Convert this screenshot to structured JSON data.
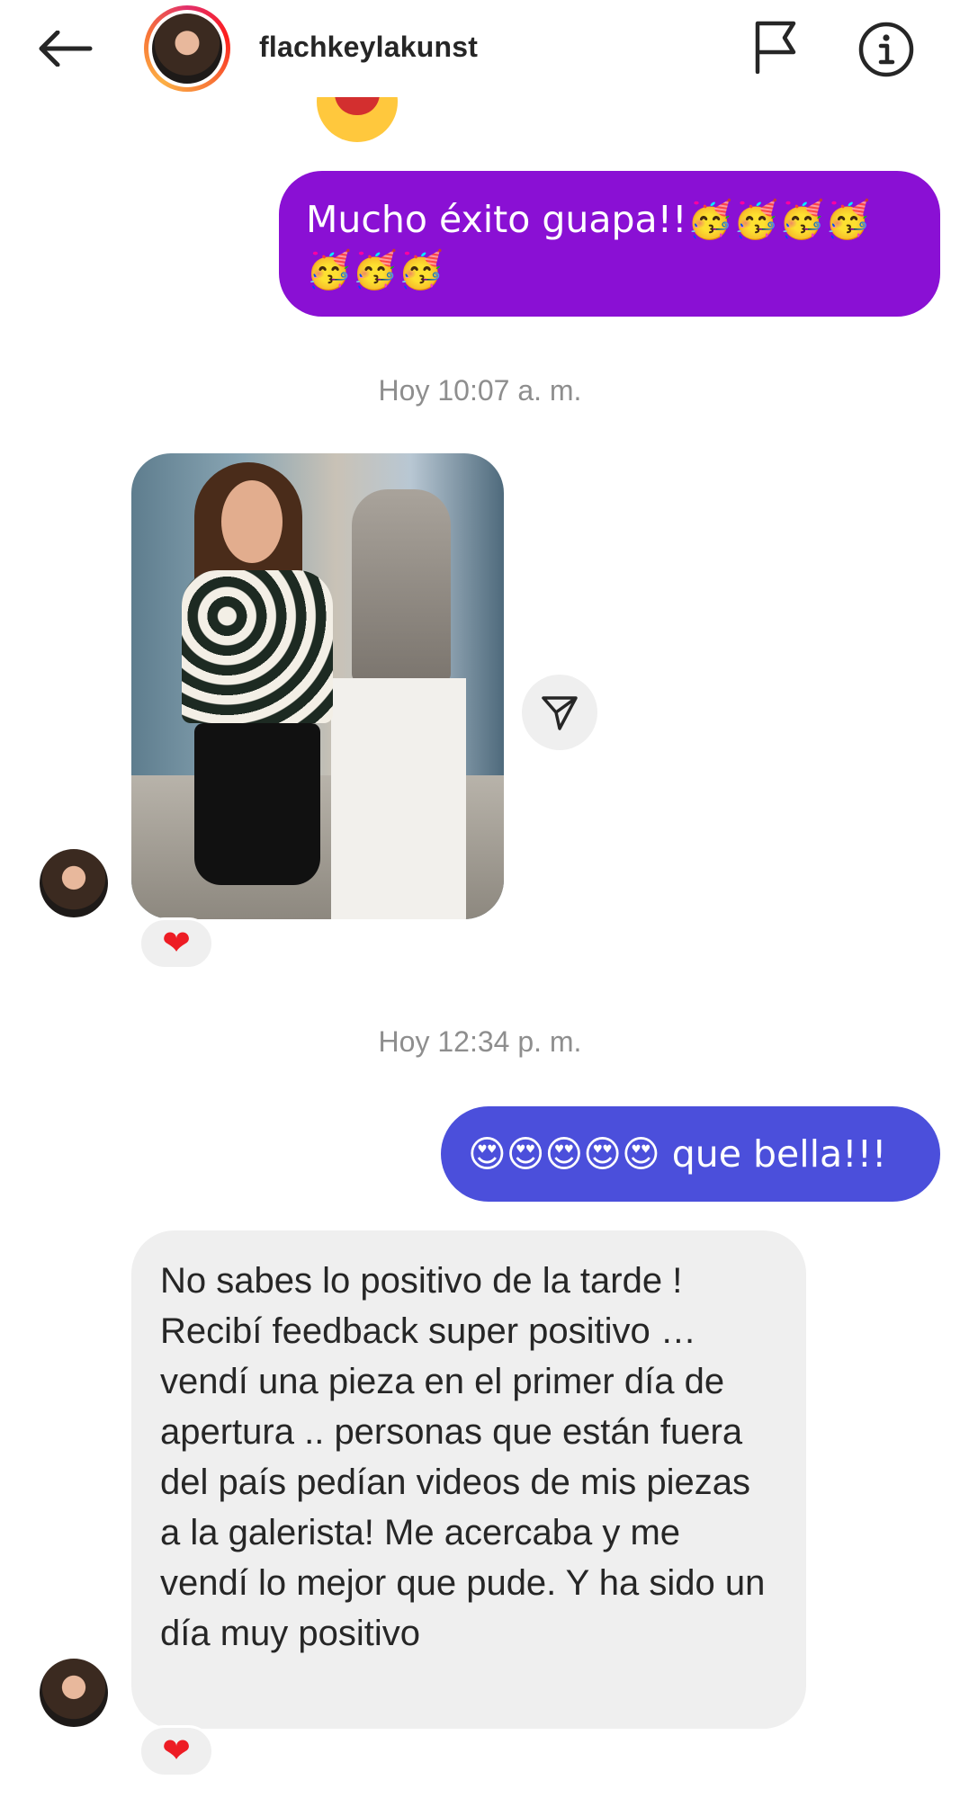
{
  "header": {
    "username": "flachkeylakunst",
    "back_icon": "arrow-left-icon",
    "flag_icon": "flag-icon",
    "info_icon": "info-icon"
  },
  "messages": {
    "sent_1": "Mucho éxito guapa!!🥳🥳🥳🥳🥳🥳🥳",
    "timestamp_1": "Hoy 10:07 a. m.",
    "timestamp_2": "Hoy 12:34 p. m.",
    "sent_2": "😍😍😍😍😍 que bella!!!",
    "received_1": "No sabes lo positivo de la tarde ! Recibí feedback super positivo … vendí una pieza en el primer día de apertura .. personas que están fuera del país pedían videos de mis piezas a la galerista!  Me acercaba y me vendí lo mejor que pude. Y ha sido un día muy positivo"
  },
  "reactions": {
    "photo_reaction": "❤",
    "text_reaction": "❤"
  },
  "colors": {
    "sent_purple": "#8a10d4",
    "sent_blue": "#4b4fdb",
    "received_bg": "#efefef",
    "timestamp": "#8e8e8e",
    "heart": "#ed1c24"
  }
}
